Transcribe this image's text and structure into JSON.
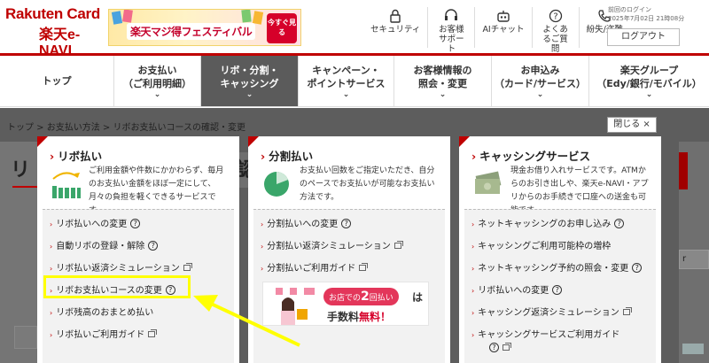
{
  "brand": {
    "top": "Rakuten Card",
    "sub": "楽天e-NAVI"
  },
  "banner": {
    "text": "楽天マジ得フェスティバル",
    "button": "今すぐ見る"
  },
  "header_icons": [
    {
      "label": "セキュリティ",
      "icon": "lock-icon"
    },
    {
      "label": "お客様サポート",
      "icon": "headset-icon"
    },
    {
      "label": "AIチャット",
      "icon": "robot-icon"
    },
    {
      "label": "よくあるご質問",
      "icon": "question-icon"
    },
    {
      "label": "紛失/盗難",
      "icon": "phone-icon"
    }
  ],
  "login": {
    "label": "前回のログイン",
    "time": "2025年7月02日 21時08分",
    "logout": "ログアウト"
  },
  "nav": [
    {
      "line1": "トップ",
      "line2": ""
    },
    {
      "line1": "お支払い",
      "line2": "（ご利用明細）"
    },
    {
      "line1": "リボ・分割・",
      "line2": "キャッシング"
    },
    {
      "line1": "キャンペーン・",
      "line2": "ポイントサービス"
    },
    {
      "line1": "お客様情報の",
      "line2": "照会・変更"
    },
    {
      "line1": "お申込み",
      "line2": "（カード/サービス）"
    },
    {
      "line1": "楽天グループ",
      "line2": "（Edy/銀行/モバイル）"
    }
  ],
  "breadcrumb": "トップ > お支払い方法 > リボお支払いコースの確認・変更",
  "close_label": "閉じる ×",
  "bg": {
    "heading_left": "リ",
    "heading_mid": "認",
    "select": "r"
  },
  "panels": [
    {
      "title": "リボ払い",
      "desc": "ご利用金額や件数にかかわらず、毎月のお支払い金額をほぼ一定にして、月々の負担を軽くできるサービスです。",
      "items": [
        {
          "label": "リボ払いへの変更",
          "suffix": "?"
        },
        {
          "label": "自動リボの登録・解除",
          "suffix": "?"
        },
        {
          "label": "リボ払い返済シミュレーション",
          "suffix": "ext"
        },
        {
          "label": "リボお支払いコースの変更",
          "suffix": "?"
        },
        {
          "label": "リボ残高のおまとめ払い",
          "suffix": ""
        },
        {
          "label": "リボ払いご利用ガイド",
          "suffix": "ext"
        }
      ]
    },
    {
      "title": "分割払い",
      "desc": "お支払い回数をご指定いただき、自分のペースでお支払いが可能なお支払い方法です。",
      "items": [
        {
          "label": "分割払いへの変更",
          "suffix": "?"
        },
        {
          "label": "分割払い返済シミュレーション",
          "suffix": "ext"
        },
        {
          "label": "分割払いご利用ガイド",
          "suffix": "ext"
        }
      ],
      "promo": {
        "pre": "お店での",
        "num": "2",
        "mid": "回払い",
        "tail": "は",
        "line2a": "手数料",
        "line2b": "無料！"
      }
    },
    {
      "title": "キャッシングサービス",
      "desc": "現金お借り入れサービスです。ATMからのお引き出しや、楽天e-NAVI・アプリからのお手続きで口座への送金も可能です。",
      "items": [
        {
          "label": "ネットキャッシングのお申し込み",
          "suffix": "?"
        },
        {
          "label": "キャッシングご利用可能枠の増枠",
          "suffix": ""
        },
        {
          "label": "ネットキャッシング予約の照会・変更",
          "suffix": "?"
        },
        {
          "label": "リボ払いへの変更",
          "suffix": "?"
        },
        {
          "label": "キャッシング返済シミュレーション",
          "suffix": "ext"
        },
        {
          "label": "キャッシングサービスご利用ガイド",
          "suffix": ""
        }
      ]
    }
  ],
  "colors": {
    "brand_red": "#bf0000",
    "highlight": "#ffff00",
    "overlay": "#5d5d5d"
  }
}
